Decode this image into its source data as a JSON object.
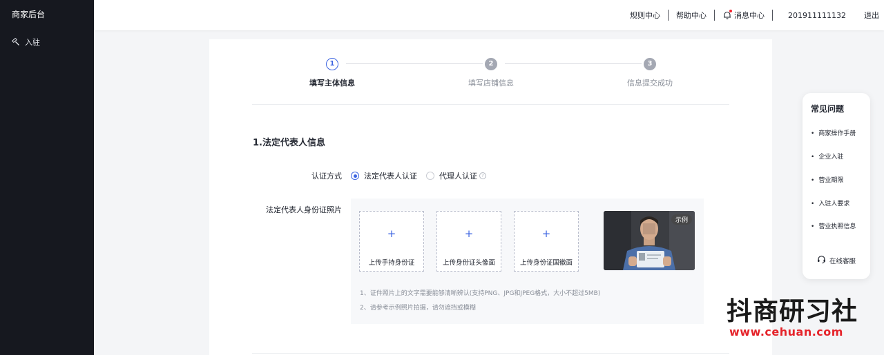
{
  "sidebar": {
    "brand": "商家后台",
    "items": [
      {
        "label": "入驻",
        "icon": "hammer-icon"
      }
    ]
  },
  "topbar": {
    "rules": "规则中心",
    "help": "帮助中心",
    "messages": "消息中心",
    "account": "201911111132",
    "logout": "退出"
  },
  "steps": [
    {
      "num": "1",
      "label": "填写主体信息",
      "state": "active"
    },
    {
      "num": "2",
      "label": "填写店铺信息",
      "state": "todo"
    },
    {
      "num": "3",
      "label": "信息提交成功",
      "state": "todo"
    }
  ],
  "section": {
    "title": "1.法定代表人信息",
    "auth_label": "认证方式",
    "auth_options": [
      {
        "label": "法定代表人认证",
        "checked": true
      },
      {
        "label": "代理人认证",
        "checked": false
      }
    ],
    "photo_label": "法定代表人身份证照片",
    "uploads": [
      {
        "label": "上传手持身份证"
      },
      {
        "label": "上传身份证头像面"
      },
      {
        "label": "上传身份证国徽面"
      }
    ],
    "sample_badge": "示例",
    "hints": [
      "1、证件照片上的文字需要能够清晰辨认(支持PNG、JPG和JPEG格式，大小不超过5MB)",
      "2、请参考示例照片拍摄，请勿遮挡或模糊"
    ]
  },
  "faq": {
    "title": "常见问题",
    "items": [
      "商家操作手册",
      "企业入驻",
      "营业期限",
      "入驻人要求",
      "营业执照信息"
    ],
    "service": "在线客服"
  },
  "watermark": {
    "text": "抖商研习社",
    "url": "www.cehuan.com"
  },
  "colors": {
    "accent": "#3d65e1",
    "sidebar_bg": "#16181f",
    "page_bg": "#f4f5f7"
  }
}
